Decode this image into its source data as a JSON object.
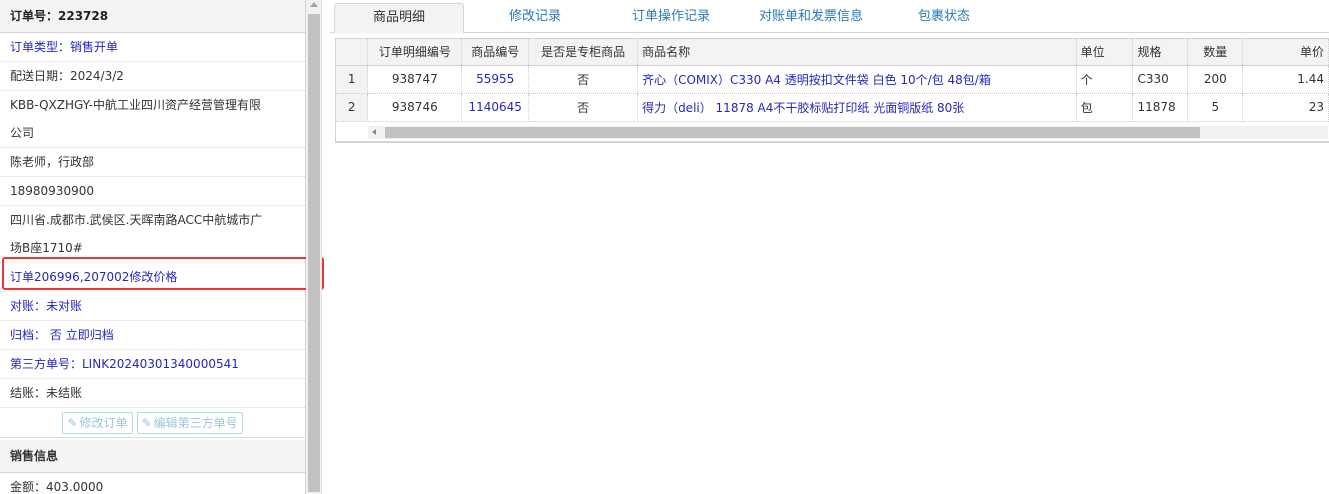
{
  "order": {
    "header": "订单号：223728",
    "type": "订单类型：销售开单",
    "delivery_date": "配送日期：2024/3/2",
    "customer_line1": "KBB-QXZHGY-中航工业四川资产经营管理有限",
    "customer_line2": "公司",
    "contact": "陈老师，行政部",
    "phone": "18980930900",
    "address_line1": "四川省.成都市.武侯区.天晖南路ACC中航城市广",
    "address_line2": "场B座1710#",
    "note": "订单206996,207002修改价格",
    "reconcile": "对账：未对账",
    "archive_label": "归档：",
    "archive_value": "否",
    "archive_link": "立即归档",
    "third_party": "第三方单号：LINK20240301340000541",
    "settlement": "结账：未结账",
    "edit_order_btn": "修改订单",
    "edit_third_btn": "编辑第三方单号"
  },
  "sales": {
    "header": "销售信息",
    "amount": "金额：403.0000"
  },
  "tabs": [
    {
      "label": "商品明细",
      "active": true
    },
    {
      "label": "修改记录"
    },
    {
      "label": "订单操作记录"
    },
    {
      "label": "对账单和发票信息"
    },
    {
      "label": "包裹状态"
    }
  ],
  "table": {
    "columns": [
      "订单明细编号",
      "商品编号",
      "是否是专柜商品",
      "商品名称",
      "单位",
      "规格",
      "数量",
      "单价"
    ],
    "rows": [
      {
        "idx": "1",
        "detail_id": "938747",
        "product_id": "55955",
        "counter": "否",
        "name": "齐心（COMIX）C330 A4 透明按扣文件袋 白色 10个/包 48包/箱",
        "unit": "个",
        "spec": "C330",
        "qty": "200",
        "price": "1.44"
      },
      {
        "idx": "2",
        "detail_id": "938746",
        "product_id": "1140645",
        "counter": "否",
        "name": "得力（deli） 11878 A4不干胶标贴打印纸 光面铜版纸 80张",
        "unit": "包",
        "spec": "11878",
        "qty": "5",
        "price": "23"
      }
    ]
  }
}
